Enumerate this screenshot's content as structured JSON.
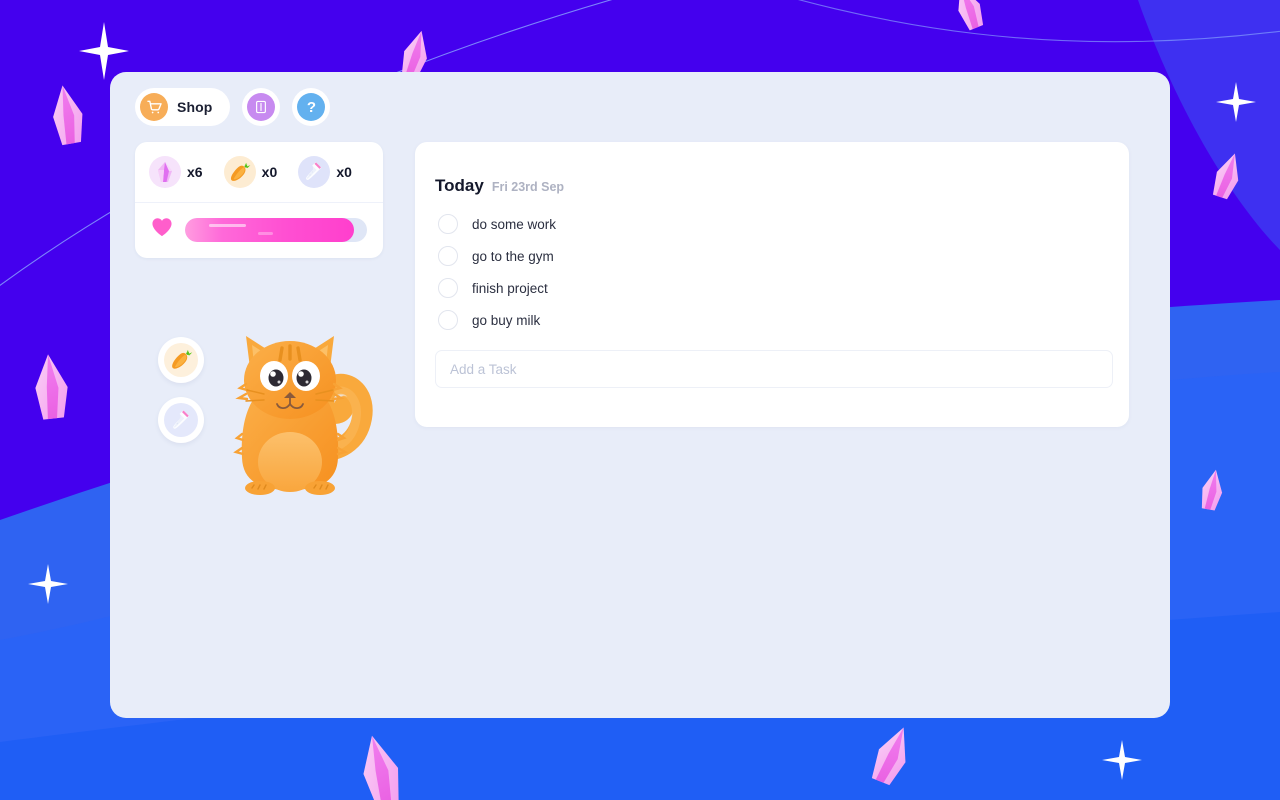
{
  "toolbar": {
    "shop_label": "Shop",
    "shop_icon": "shopping-cart-icon",
    "journal_icon": "book-icon",
    "help_icon": "question-mark-icon",
    "help_label": "?"
  },
  "inventory": {
    "items": [
      {
        "icon": "gem-icon",
        "name": "gem",
        "count": "x6"
      },
      {
        "icon": "carrot-icon",
        "name": "carrot",
        "count": "x0"
      },
      {
        "icon": "milk-icon",
        "name": "milk",
        "count": "x0"
      }
    ],
    "health": {
      "icon": "heart-icon",
      "fill_percent": 93
    }
  },
  "pet": {
    "name": "orange-cat",
    "actions": [
      {
        "icon": "carrot-icon",
        "name": "feed-carrot"
      },
      {
        "icon": "milk-icon",
        "name": "feed-milk"
      }
    ]
  },
  "tasks": {
    "heading": "Today",
    "date": "Fri 23rd Sep",
    "items": [
      {
        "label": "do some work",
        "done": false
      },
      {
        "label": "go to the gym",
        "done": false
      },
      {
        "label": "finish project",
        "done": false
      },
      {
        "label": "go buy milk",
        "done": false
      }
    ],
    "add_placeholder": "Add a Task",
    "add_value": ""
  },
  "colors": {
    "bg_purple": "#4400ee",
    "bg_blue": "#1f5ef5",
    "panel": "#e8edf9",
    "accent_pink": "#ff3fcd",
    "crystal_pink": "#f7a9ef",
    "cart_orange": "#f7ad58",
    "book_purple": "#c78af0",
    "help_blue": "#63b1ef"
  }
}
